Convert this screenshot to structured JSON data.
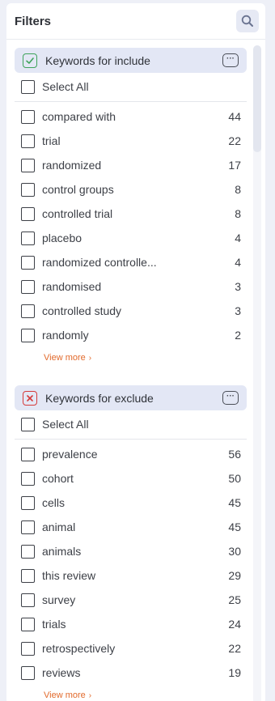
{
  "header": {
    "title": "Filters",
    "search_icon": "search-icon"
  },
  "include": {
    "title": "Keywords for include",
    "select_all": "Select All",
    "items": [
      {
        "label": "compared with",
        "count": "44"
      },
      {
        "label": "trial",
        "count": "22"
      },
      {
        "label": "randomized",
        "count": "17"
      },
      {
        "label": "control groups",
        "count": "8"
      },
      {
        "label": "controlled trial",
        "count": "8"
      },
      {
        "label": "placebo",
        "count": "4"
      },
      {
        "label": "randomized controlle...",
        "count": "4"
      },
      {
        "label": "randomised",
        "count": "3"
      },
      {
        "label": "controlled study",
        "count": "3"
      },
      {
        "label": "randomly",
        "count": "2"
      }
    ],
    "view_more": "View more",
    "accent": "#3fa35b"
  },
  "exclude": {
    "title": "Keywords for exclude",
    "select_all": "Select All",
    "items": [
      {
        "label": "prevalence",
        "count": "56"
      },
      {
        "label": "cohort",
        "count": "50"
      },
      {
        "label": "cells",
        "count": "45"
      },
      {
        "label": "animal",
        "count": "45"
      },
      {
        "label": "animals",
        "count": "30"
      },
      {
        "label": "this review",
        "count": "29"
      },
      {
        "label": "survey",
        "count": "25"
      },
      {
        "label": "trials",
        "count": "24"
      },
      {
        "label": "retrospectively",
        "count": "22"
      },
      {
        "label": "reviews",
        "count": "19"
      }
    ],
    "view_more": "View more",
    "accent": "#d53b3b"
  },
  "colors": {
    "link": "#e26a2c",
    "group_bg": "#e3e7f5"
  }
}
